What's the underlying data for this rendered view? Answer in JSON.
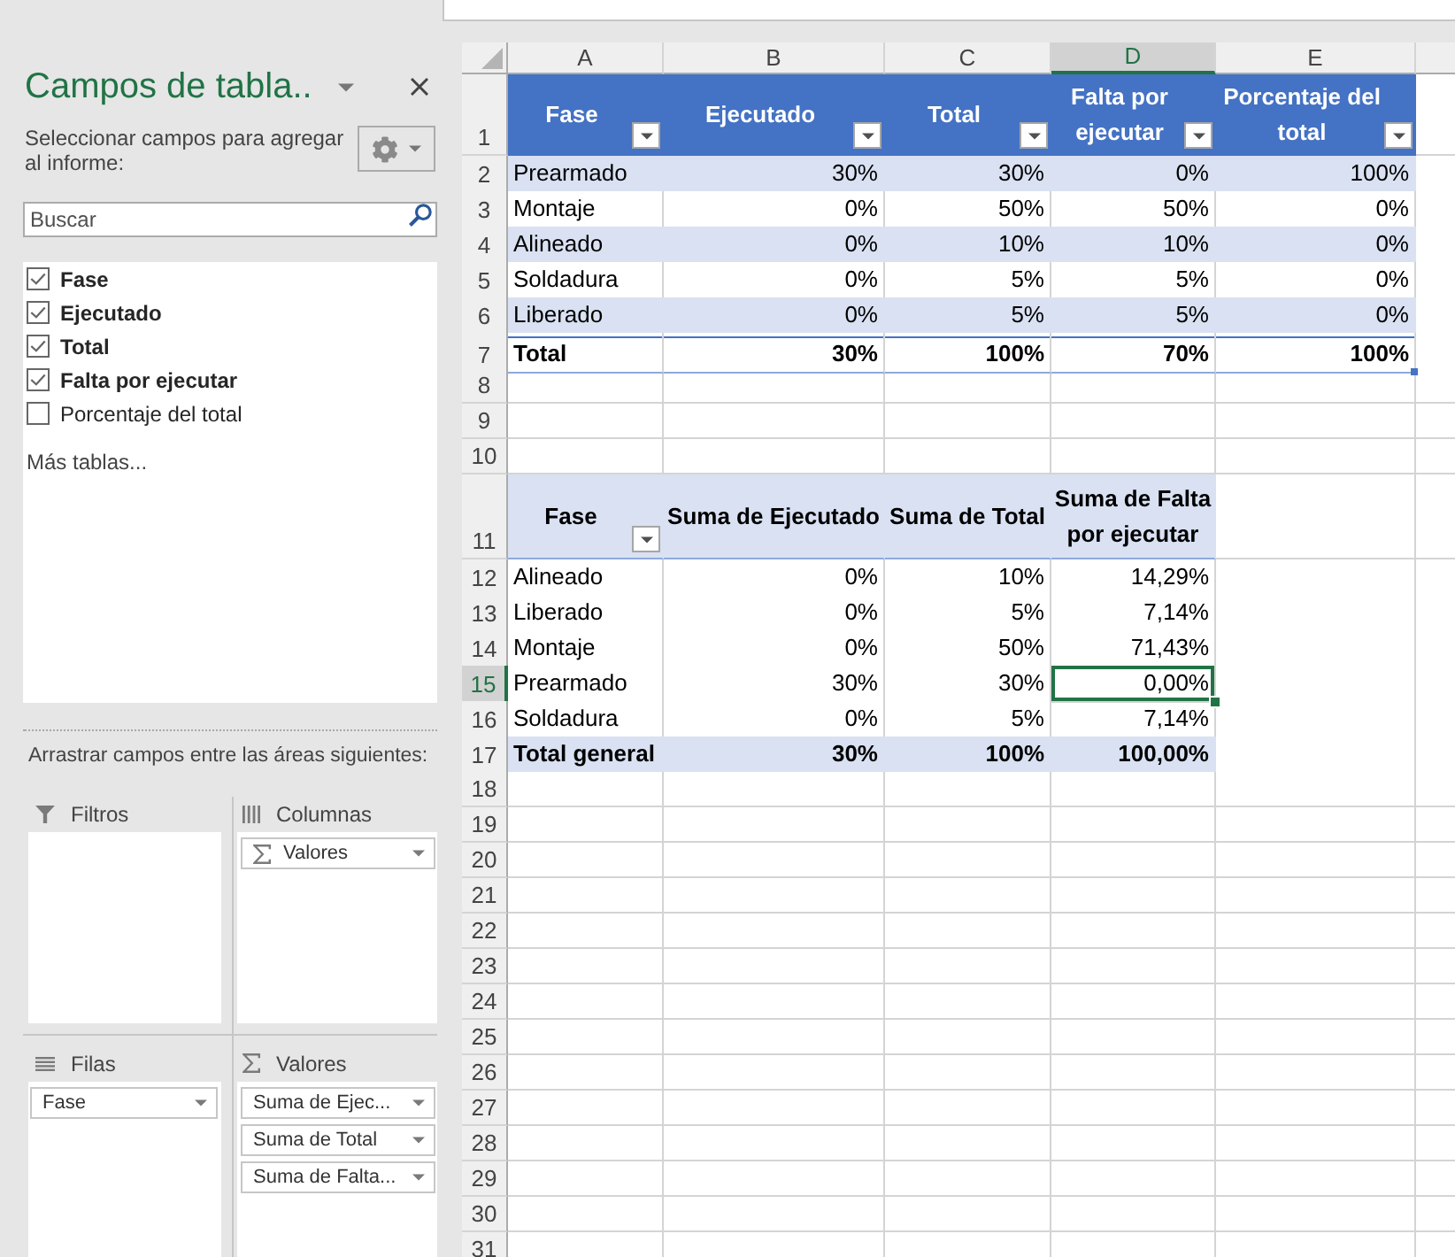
{
  "field_list": {
    "title": "Campos de tabla..",
    "instruction": "Seleccionar campos para agregar al informe:",
    "search": {
      "placeholder": "Buscar"
    },
    "fields": [
      {
        "label": "Fase",
        "checked": true
      },
      {
        "label": "Ejecutado",
        "checked": true
      },
      {
        "label": "Total",
        "checked": true
      },
      {
        "label": "Falta por ejecutar",
        "checked": true
      },
      {
        "label": "Porcentaje del total",
        "checked": false
      }
    ],
    "more_tables": "Más tablas...",
    "areas_hint": "Arrastrar campos entre las áreas siguientes:",
    "areas": [
      {
        "kind": "filters",
        "title": "Filtros"
      },
      {
        "kind": "columns",
        "title": "Columnas",
        "fields": [
          {
            "label": "Valores",
            "kind": "values"
          }
        ]
      },
      {
        "kind": "rows",
        "title": "Filas",
        "fields": [
          {
            "label": "Fase",
            "kind": "field"
          }
        ]
      },
      {
        "kind": "values",
        "title": "Valores",
        "fields": [
          {
            "label": "Suma de Ejec...",
            "kind": "field"
          },
          {
            "label": "Suma de Total",
            "kind": "field"
          },
          {
            "label": "Suma de Falta...",
            "kind": "field"
          }
        ]
      }
    ]
  },
  "sheet": {
    "column_headers": [
      {
        "label": "A",
        "selected": false
      },
      {
        "label": "B",
        "selected": false
      },
      {
        "label": "C",
        "selected": false
      },
      {
        "label": "D",
        "selected": true
      },
      {
        "label": "E",
        "selected": false
      }
    ],
    "row_headers": [
      {
        "label": "1",
        "selected": false
      },
      {
        "label": "2",
        "selected": false
      },
      {
        "label": "3",
        "selected": false
      },
      {
        "label": "4",
        "selected": false
      },
      {
        "label": "5",
        "selected": false
      },
      {
        "label": "6",
        "selected": false
      },
      {
        "label": "7",
        "selected": false
      },
      {
        "label": "8",
        "selected": false
      },
      {
        "label": "9",
        "selected": false
      },
      {
        "label": "10",
        "selected": false
      },
      {
        "label": "11",
        "selected": false
      },
      {
        "label": "12",
        "selected": false
      },
      {
        "label": "13",
        "selected": false
      },
      {
        "label": "14",
        "selected": false
      },
      {
        "label": "15",
        "selected": true
      },
      {
        "label": "16",
        "selected": false
      },
      {
        "label": "17",
        "selected": false
      },
      {
        "label": "18",
        "selected": false
      },
      {
        "label": "19",
        "selected": false
      },
      {
        "label": "20",
        "selected": false
      },
      {
        "label": "21",
        "selected": false
      },
      {
        "label": "22",
        "selected": false
      },
      {
        "label": "23",
        "selected": false
      },
      {
        "label": "24",
        "selected": false
      },
      {
        "label": "25",
        "selected": false
      },
      {
        "label": "26",
        "selected": false
      },
      {
        "label": "27",
        "selected": false
      },
      {
        "label": "28",
        "selected": false
      },
      {
        "label": "29",
        "selected": false
      },
      {
        "label": "30",
        "selected": false
      },
      {
        "label": "31",
        "selected": false
      }
    ],
    "table": {
      "columns": [
        {
          "label": "Fase",
          "filter": true
        },
        {
          "label": "Ejecutado",
          "filter": true
        },
        {
          "label": "Total",
          "filter": true
        },
        {
          "label": "Falta por ejecutar",
          "filter": true
        },
        {
          "label": "Porcentaje del total",
          "filter": true
        }
      ],
      "rows": [
        [
          "Prearmado",
          "30%",
          "30%",
          "0%",
          "100%"
        ],
        [
          "Montaje",
          "0%",
          "50%",
          "50%",
          "0%"
        ],
        [
          "Alineado",
          "0%",
          "10%",
          "10%",
          "0%"
        ],
        [
          "Soldadura",
          "0%",
          "5%",
          "5%",
          "0%"
        ],
        [
          "Liberado",
          "0%",
          "5%",
          "5%",
          "0%"
        ]
      ],
      "total_row": [
        "Total",
        "30%",
        "100%",
        "70%",
        "100%"
      ]
    },
    "pivot": {
      "columns": [
        {
          "label": "Fase",
          "filter": true
        },
        {
          "label": "Suma de Ejecutado",
          "filter": false
        },
        {
          "label": "Suma de Total",
          "filter": false
        },
        {
          "label": "Suma de Falta por ejecutar",
          "filter": false
        }
      ],
      "rows": [
        [
          "Alineado",
          "0%",
          "10%",
          "14,29%"
        ],
        [
          "Liberado",
          "0%",
          "5%",
          "7,14%"
        ],
        [
          "Montaje",
          "0%",
          "50%",
          "71,43%"
        ],
        [
          "Prearmado",
          "30%",
          "30%",
          "0,00%"
        ],
        [
          "Soldadura",
          "0%",
          "5%",
          "7,14%"
        ]
      ],
      "grand_total": [
        "Total general",
        "30%",
        "100%",
        "100,00%"
      ]
    }
  }
}
